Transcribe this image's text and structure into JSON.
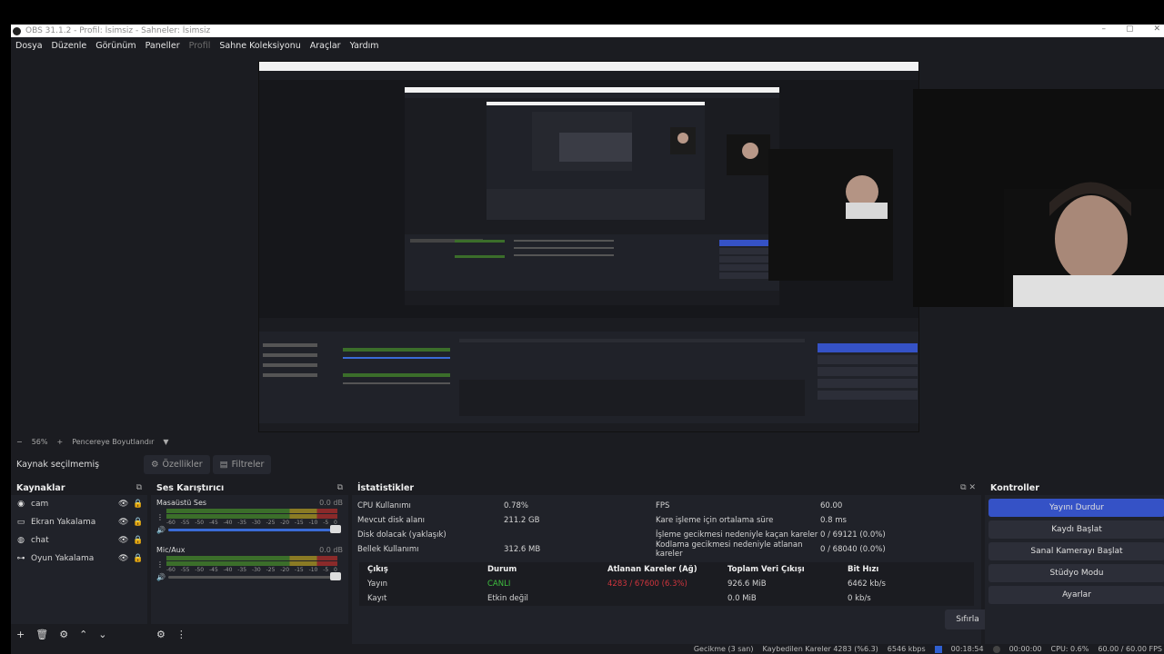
{
  "window": {
    "title": "OBS 31.1.2 - Profil: İsimsiz - Sahneler: İsimsiz",
    "minimize": "–",
    "maximize": "▢",
    "close": "✕"
  },
  "menu": {
    "items": [
      "Dosya",
      "Düzenle",
      "Görünüm",
      "Paneller",
      "Profil",
      "Sahne Koleksiyonu",
      "Araçlar",
      "Yardım"
    ]
  },
  "zoom": {
    "minus": "−",
    "value": "56%",
    "plus": "+",
    "fit_label": "Pencereye Boyutlandır",
    "dropdown": "▼"
  },
  "source_bar": {
    "label": "Kaynak seçilmemiş",
    "properties": "Özellikler",
    "filters": "Filtreler"
  },
  "sources": {
    "title": "Kaynaklar",
    "items": [
      {
        "label": "cam",
        "icon": "camera-icon"
      },
      {
        "label": "Ekran Yakalama",
        "icon": "monitor-icon"
      },
      {
        "label": "chat",
        "icon": "globe-icon"
      },
      {
        "label": "Oyun Yakalama",
        "icon": "gamepad-icon"
      }
    ]
  },
  "mixer": {
    "title": "Ses Karıştırıcı",
    "channels": [
      {
        "name": "Masaüstü Ses",
        "db": "0.0 dB"
      },
      {
        "name": "Mic/Aux",
        "db": "0.0 dB"
      }
    ],
    "scale": [
      "-60",
      "-55",
      "-50",
      "-45",
      "-40",
      "-35",
      "-30",
      "-25",
      "-20",
      "-15",
      "-10",
      "-5",
      "0"
    ]
  },
  "stats": {
    "title": "İstatistikler",
    "left": [
      {
        "k": "CPU Kullanımı",
        "v": "0.78%"
      },
      {
        "k": "Mevcut disk alanı",
        "v": "211.2 GB"
      },
      {
        "k": "Disk dolacak (yaklaşık)",
        "v": ""
      },
      {
        "k": "Bellek Kullanımı",
        "v": "312.6 MB"
      }
    ],
    "right": [
      {
        "k": "FPS",
        "v": "60.00"
      },
      {
        "k": "Kare işleme için ortalama süre",
        "v": "0.8 ms"
      },
      {
        "k": "İşleme gecikmesi nedeniyle kaçan kareler",
        "v": "0 / 69121 (0.0%)"
      },
      {
        "k": "Kodlama gecikmesi nedeniyle atlanan kareler",
        "v": "0 / 68040 (0.0%)"
      }
    ],
    "table": {
      "headers": [
        "Çıkış",
        "Durum",
        "Atlanan Kareler (Ağ)",
        "Toplam Veri Çıkışı",
        "Bit Hızı"
      ],
      "rows": [
        [
          "Yayın",
          "CANLI",
          "4283 / 67600 (6.3%)",
          "926.6 MiB",
          "6462 kb/s"
        ],
        [
          "Kayıt",
          "Etkin değil",
          "",
          "0.0 MiB",
          "0 kb/s"
        ]
      ]
    },
    "reset": "Sıfırla"
  },
  "controls": {
    "title": "Kontroller",
    "buttons": [
      "Yayını Durdur",
      "Kaydı Başlat",
      "Sanal Kamerayı Başlat",
      "Stüdyo Modu",
      "Ayarlar"
    ]
  },
  "statusbar": {
    "delay": "Gecikme (3 san)",
    "dropped": "Kaybedilen Kareler 4283 (%6.3)",
    "bitrate": "6546 kbps",
    "stream_time": "00:18:54",
    "rec_time": "00:00:00",
    "cpu": "CPU: 0.6%",
    "fps": "60.00 / 60.00 FPS"
  },
  "colors": {
    "accent": "#3552c6",
    "live": "#3fbf3f",
    "dropped": "#d0353d"
  }
}
